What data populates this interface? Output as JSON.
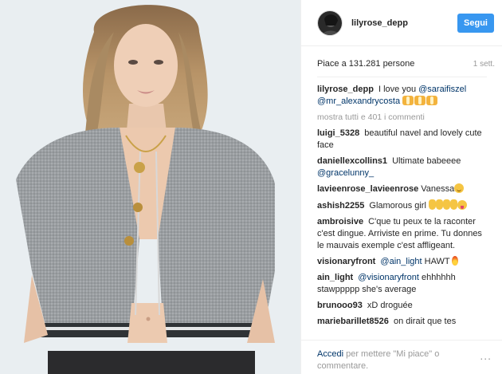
{
  "post": {
    "username": "lilyrose_depp",
    "follow_label": "Segui",
    "likes_text": "Piace a 131.281 persone",
    "time_ago": "1 sett."
  },
  "caption": {
    "author": "lilyrose_depp",
    "text": "I love you",
    "mention_1": "@saraifiszel",
    "mention_2": "@mr_alexandrycosta",
    "emoji": "raising-hands-emoji"
  },
  "show_all_comments": "mostra tutti e 401 i commenti",
  "comments": [
    {
      "author": "luigi_5328",
      "text": "beautiful navel and lovely cute face"
    },
    {
      "author": "daniellexcollins1",
      "text": "Ultimate babeeee",
      "mention": "@gracelunny_"
    },
    {
      "author": "lavieenrose_lavieenrose",
      "text": "Vanessa",
      "emoji": "smiling-face-emoji"
    },
    {
      "author": "ashish2255",
      "text": "Glamorous girl",
      "emoji": "ok-hand-emoji",
      "emoji_2": "tongue-face-emoji"
    },
    {
      "author": "ambroisive",
      "text": "C'que tu peux te la raconter c'est dingue. Arriviste en prime. Tu donnes le mauvais exemple c'est affligeant."
    },
    {
      "author": "visionaryfront",
      "mention": "@ain_light",
      "text": "HAWT",
      "emoji": "fire-emoji"
    },
    {
      "author": "ain_light",
      "mention": "@visionaryfront",
      "text": "ehhhhhh stawppppp she's average"
    },
    {
      "author": "brunooo93",
      "text": "xD droguée"
    },
    {
      "author": "mariebarillet8526",
      "text": "on dirait que tes"
    }
  ],
  "footer": {
    "login_label": "Accedi",
    "text": "per mettere \"Mi piace\" o commentare.",
    "more_icon": "ellipsis-icon",
    "more_label": "..."
  },
  "colors": {
    "accent": "#3897f0",
    "link": "#003569",
    "muted": "#999999",
    "text": "#262626"
  }
}
